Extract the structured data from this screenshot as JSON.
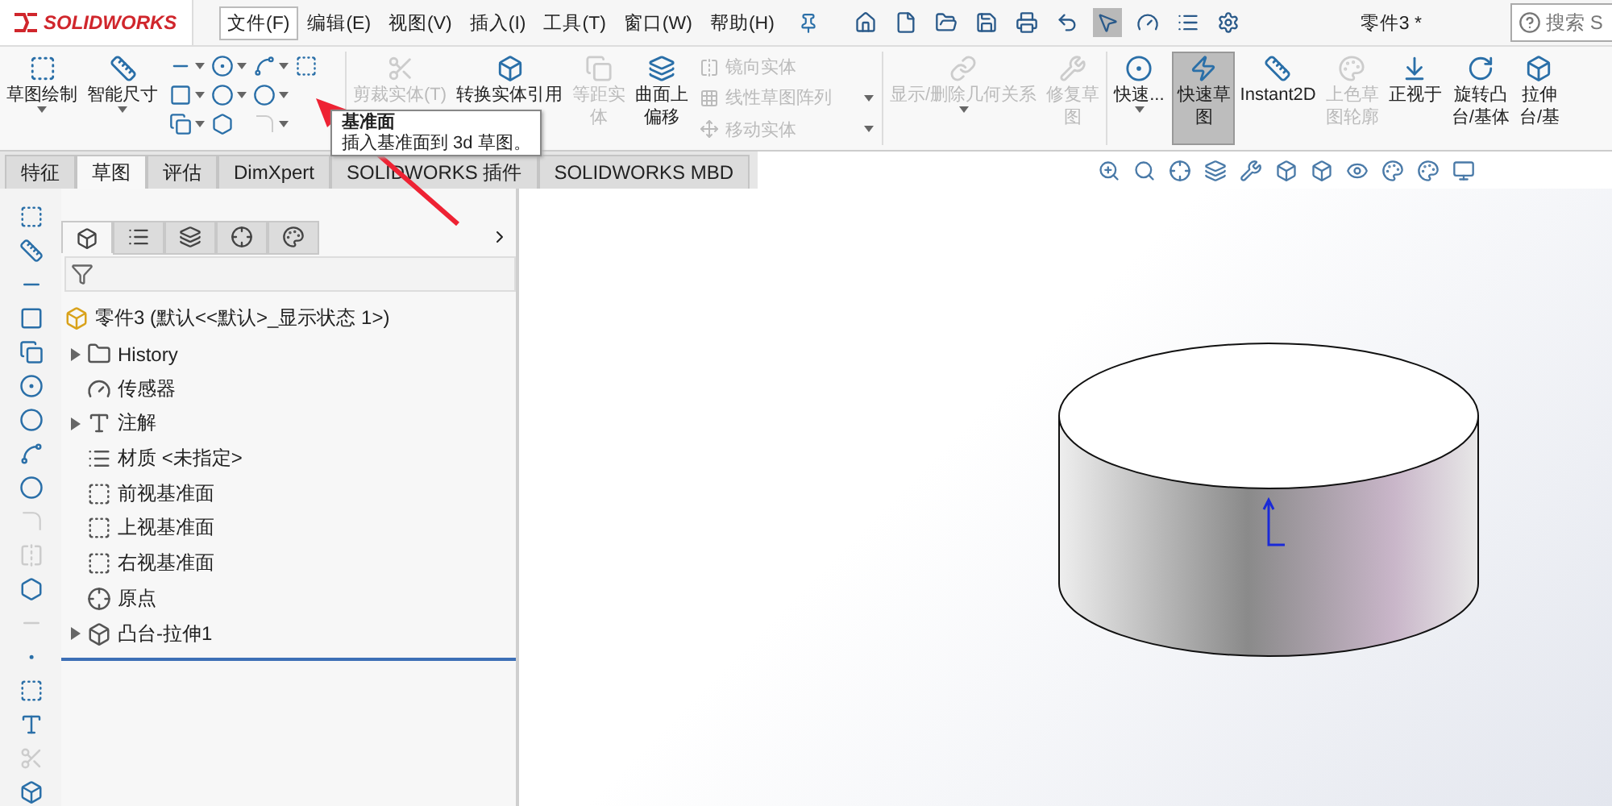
{
  "app_logo": "SOLIDWORKS",
  "menu": [
    {
      "label": "文件(F)",
      "selected": true
    },
    {
      "label": "编辑(E)",
      "selected": false
    },
    {
      "label": "视图(V)",
      "selected": false
    },
    {
      "label": "插入(I)",
      "selected": false
    },
    {
      "label": "工具(T)",
      "selected": false
    },
    {
      "label": "窗口(W)",
      "selected": false
    },
    {
      "label": "帮助(H)",
      "selected": false
    }
  ],
  "quick_access": [
    {
      "selected": false
    },
    {
      "selected": false
    },
    {
      "selected": false
    },
    {
      "selected": false
    },
    {
      "selected": false
    },
    {
      "selected": false
    },
    {
      "selected": true
    },
    {
      "selected": false
    },
    {
      "selected": false
    },
    {
      "selected": false
    }
  ],
  "document_title": "零件3 *",
  "search": {
    "placeholder": "搜索 S"
  },
  "ribbon": [
    [
      {
        "kind": "large",
        "lines": [
          "草图绘制"
        ],
        "disabled": false,
        "selected": false,
        "dropdown": true
      },
      {
        "kind": "large",
        "lines": [
          "智能尺寸"
        ],
        "disabled": false,
        "selected": false,
        "dropdown": true
      },
      {
        "kind": "tools",
        "tools": [
          {
            "disabled": false,
            "dropdown": true
          },
          {
            "disabled": false,
            "dropdown": true
          },
          {
            "disabled": false,
            "dropdown": true
          },
          {
            "disabled": false,
            "dropdown": false
          },
          {
            "disabled": false,
            "dropdown": true
          },
          {
            "disabled": false,
            "dropdown": true
          },
          {
            "disabled": false,
            "dropdown": true
          },
          {
            "disabled": false,
            "dropdown": true
          },
          {
            "disabled": false,
            "dropdown": false
          },
          {
            "disabled": true,
            "dropdown": true
          }
        ]
      }
    ],
    [
      {
        "kind": "large",
        "lines": [
          "剪裁实体(T)"
        ],
        "disabled": true,
        "selected": false,
        "dropdown": false
      },
      {
        "kind": "large",
        "lines": [
          "转换实体引用"
        ],
        "disabled": false,
        "selected": false,
        "dropdown": false
      },
      {
        "kind": "large",
        "lines": [
          "等距实",
          "体"
        ],
        "disabled": true,
        "selected": false,
        "dropdown": false
      },
      {
        "kind": "large",
        "lines": [
          "曲面上",
          "偏移"
        ],
        "disabled": false,
        "selected": false,
        "dropdown": false
      },
      {
        "kind": "list",
        "items": [
          {
            "label": "镜向实体",
            "disabled": true,
            "dropdown": false
          },
          {
            "label": "线性草图阵列",
            "disabled": true,
            "dropdown": true
          },
          {
            "label": "移动实体",
            "disabled": true,
            "dropdown": true
          }
        ]
      }
    ],
    [
      {
        "kind": "large",
        "lines": [
          "显示/删除几何关系"
        ],
        "disabled": true,
        "selected": false,
        "dropdown": true
      },
      {
        "kind": "large",
        "lines": [
          "修复草",
          "图"
        ],
        "disabled": true,
        "selected": false,
        "dropdown": false
      }
    ],
    [
      {
        "kind": "large",
        "lines": [
          "快速..."
        ],
        "disabled": false,
        "selected": false,
        "dropdown": true
      }
    ],
    [
      {
        "kind": "large",
        "lines": [
          "快速草",
          "图"
        ],
        "disabled": false,
        "selected": true,
        "dropdown": false
      },
      {
        "kind": "large",
        "lines": [
          "Instant2D"
        ],
        "disabled": false,
        "selected": false,
        "dropdown": false
      },
      {
        "kind": "large",
        "lines": [
          "上色草",
          "图轮廓"
        ],
        "disabled": true,
        "selected": false,
        "dropdown": false
      },
      {
        "kind": "large",
        "lines": [
          "正视于"
        ],
        "disabled": false,
        "selected": false,
        "dropdown": false
      },
      {
        "kind": "large",
        "lines": [
          "旋转凸",
          "台/基体"
        ],
        "disabled": false,
        "selected": false,
        "dropdown": false
      },
      {
        "kind": "large",
        "lines": [
          "拉伸",
          "台/基"
        ],
        "disabled": false,
        "selected": false,
        "dropdown": false
      }
    ]
  ],
  "tooltip": {
    "title": "基准面",
    "text": "插入基准面到 3d 草图。"
  },
  "tabs": [
    {
      "label": "特征",
      "selected": false
    },
    {
      "label": "草图",
      "selected": true
    },
    {
      "label": "评估",
      "selected": false
    },
    {
      "label": "DimXpert",
      "selected": false
    },
    {
      "label": "SOLIDWORKS 插件",
      "selected": false
    },
    {
      "label": "SOLIDWORKS MBD",
      "selected": false
    }
  ],
  "side_tools": [
    {
      "disabled": false
    },
    {
      "disabled": false
    },
    {
      "disabled": false
    },
    {
      "disabled": false
    },
    {
      "disabled": false
    },
    {
      "disabled": false
    },
    {
      "disabled": false
    },
    {
      "disabled": false
    },
    {
      "disabled": false
    },
    {
      "disabled": true
    },
    {
      "disabled": true
    },
    {
      "disabled": false
    },
    {
      "disabled": true
    },
    {
      "disabled": false
    },
    {
      "disabled": false
    },
    {
      "disabled": false
    },
    {
      "disabled": true
    },
    {
      "disabled": false
    }
  ],
  "panel_tabs": [
    {
      "selected": true
    },
    {
      "selected": false
    },
    {
      "selected": false
    },
    {
      "selected": false
    },
    {
      "selected": false
    }
  ],
  "tree": {
    "root": "零件3  (默认<<默认>_显示状态 1>)",
    "items": [
      {
        "label": "History",
        "kind": "history",
        "expandable": true
      },
      {
        "label": "传感器",
        "kind": "sensors",
        "expandable": false
      },
      {
        "label": "注解",
        "kind": "annotations",
        "expandable": true
      },
      {
        "label": "材质 <未指定>",
        "kind": "material",
        "expandable": false
      },
      {
        "label": "前视基准面",
        "kind": "plane",
        "expandable": false
      },
      {
        "label": "上视基准面",
        "kind": "plane",
        "expandable": false
      },
      {
        "label": "右视基准面",
        "kind": "plane",
        "expandable": false
      },
      {
        "label": "原点",
        "kind": "origin",
        "expandable": false
      },
      {
        "label": "凸台-拉伸1",
        "kind": "extrude",
        "expandable": true
      }
    ]
  }
}
